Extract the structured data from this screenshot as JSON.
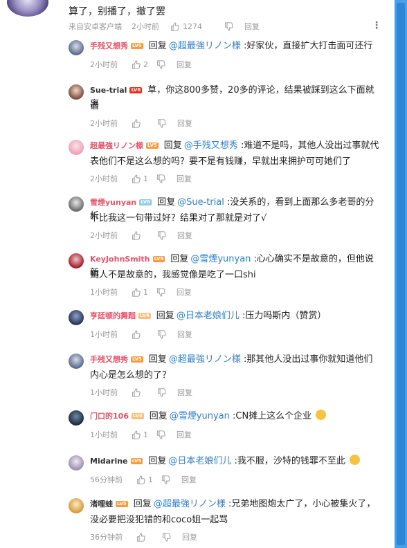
{
  "top_comment": {
    "text": "算了，别播了，撤了罢",
    "source": "来自安卓客户端",
    "time": "2小时前",
    "likes": "1274",
    "reply_label": "回复"
  },
  "ui": {
    "reply_label": "回复",
    "reply_verb": "回复"
  },
  "replies": [
    {
      "user": "手残又想秀",
      "name_color": "#e8546a",
      "level": "LV5",
      "level_color": "#ff9a3c",
      "at": "@超最強リノン様",
      "text": " :好家伙，直接扩大打击面可还行",
      "line2": "",
      "time": "2小时前",
      "likes": "2",
      "avatar_colors": [
        "#5a6b8c",
        "#d9dbe6"
      ]
    },
    {
      "user": "Sue-trial",
      "name_color": "#333333",
      "level": "LV6",
      "level_color": "#e3311e",
      "at": "",
      "text": "草，你这800多赞，20多的评论，结果被踩到这么下面就离",
      "line2": "谱",
      "time": "2小时前",
      "likes": "",
      "avatar_colors": [
        "#7a4d3a",
        "#f2d6c9"
      ]
    },
    {
      "user": "超最強リノン様",
      "name_color": "#e8546a",
      "level": "LV5",
      "level_color": "#ff9a3c",
      "at": "@手残又想秀",
      "text": " :难道不是吗，其他人没出过事就代",
      "line2": "表他们不是这么想的吗？要不是有钱赚，早就出来拥护可可她们了",
      "time": "2小时前",
      "likes": "1",
      "avatar_colors": [
        "#f0a0b8",
        "#fbe3ea"
      ]
    },
    {
      "user": "雪煙yunyan",
      "name_color": "#e8546a",
      "level": "LV6",
      "level_color": "#8fc9ea",
      "at": "@Sue-trial",
      "text": " :没关系的，看到上面那么多老哥的分析",
      "line2": "不比我这一句带过好？结果对了那就是对了√",
      "time": "2小时前",
      "likes": "",
      "avatar_colors": [
        "#6b6b6b",
        "#e6e6e6"
      ]
    },
    {
      "user": "KeyJohnSmith",
      "name_color": "#e8546a",
      "level": "LV5",
      "level_color": "#ff9a3c",
      "at": "@雪煙yunyan",
      "text": " :心心确实不是故意的，但他说新",
      "line2": "蝎人不是故意的，我感觉像是吃了一口shi",
      "time": "1小时前",
      "likes": "1",
      "avatar_colors": [
        "#a11c2a",
        "#f1c3c8"
      ]
    },
    {
      "user": "亨廷顿的舞蹈",
      "name_color": "#e8546a",
      "level": "LV4",
      "level_color": "#ffbe7a",
      "at": "@日本老娘们儿",
      "text": " :压力吗斯内（赞赏）",
      "line2": "",
      "time": "1小时前",
      "likes": "",
      "avatar_colors": [
        "#2a3452",
        "#8aa0c8"
      ]
    },
    {
      "user": "手残又想秀",
      "name_color": "#e8546a",
      "level": "LV5",
      "level_color": "#ff9a3c",
      "at": "@超最強リノン様",
      "text": " :那其他人没出过事你就知道他们",
      "line2": "内心是怎么想的了？",
      "time": "1小时前",
      "likes": "",
      "avatar_colors": [
        "#5a6b8c",
        "#d9dbe6"
      ]
    },
    {
      "user": "门口的106",
      "name_color": "#e8546a",
      "level": "LV4",
      "level_color": "#ffbe7a",
      "at": "@雪煙yunyan",
      "text": " :CN摊上这么个企业",
      "line2": "",
      "time": "1小时前",
      "likes": "1",
      "avatar_colors": [
        "#1f2b3a",
        "#6b8aa8"
      ]
    },
    {
      "user": "Midarine",
      "name_color": "#333333",
      "level": "LV5",
      "level_color": "#ff9a3c",
      "at": "@日本老娘们儿",
      "text": " :我不服，沙特的钱罪不至此",
      "line2": "",
      "time": "56分钟前",
      "likes": "1",
      "avatar_colors": [
        "#9b8fb0",
        "#efe9f5"
      ]
    },
    {
      "user": "渚哩蛙",
      "name_color": "#333333",
      "level": "LV5",
      "level_color": "#ff9a3c",
      "at": "@超最強リノン様",
      "text": " :兄弟地图炮太广了，小心被集火了，",
      "line2": "没必要把没犯错的和coco姐一起骂",
      "time": "36分钟前",
      "likes": "",
      "avatar_colors": [
        "#d69a3a",
        "#fbe8c4"
      ]
    }
  ],
  "colors": {
    "accent": "#2f7fd0",
    "scrollbar": "#4aa0e6"
  }
}
